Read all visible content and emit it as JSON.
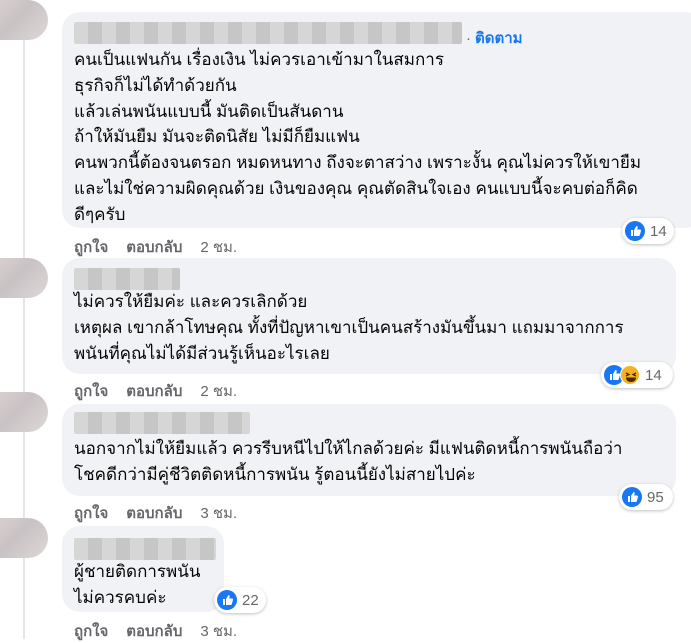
{
  "colors": {
    "bubble": "#f0f2f5",
    "link": "#1877f2",
    "secondary": "#65676b",
    "like": "#1877f2",
    "haha": "#f7b125"
  },
  "comments": [
    {
      "follow_dot": "·",
      "follow_label": "ติดตาม",
      "text": "คนเป็นแฟนกัน เรื่องเงิน ไม่ควรเอาเข้ามาในสมการ\nธุรกิจก็ไม่ได้ทำด้วยกัน\nแล้วเล่นพนันแบบนี้ มันติดเป็นสันดาน\nถ้าให้มันยืม มันจะติดนิสัย ไม่มีก็ยืมแฟน\nคนพวกนี้ต้องจนตรอก หมดหนทาง ถึงจะตาสว่าง เพราะงั้น คุณไม่ควรให้เขายืม\nและไม่ใช่ความผิดคุณด้วย เงินของคุณ คุณตัดสินใจเอง คนแบบนี้จะคบต่อก็คิด\nดีๆครับ",
      "like_label": "ถูกใจ",
      "reply_label": "ตอบกลับ",
      "time": "2 ชม.",
      "reactions": [
        "like-icon"
      ],
      "reaction_count": "14"
    },
    {
      "text": "ไม่ควรให้ยืมค่ะ และควรเลิกด้วย\nเหตุผล เขากล้าโทษคุณ ทั้งที่ปัญหาเขาเป็นคนสร้างมันขึ้นมา แถมมาจากการ\nพนันที่คุณไม่ได้มีส่วนรู้เห็นอะไรเลย",
      "like_label": "ถูกใจ",
      "reply_label": "ตอบกลับ",
      "time": "2 ชม.",
      "reactions": [
        "like-icon",
        "haha-icon"
      ],
      "reaction_count": "14"
    },
    {
      "text": "นอกจากไม่ให้ยืมแล้ว ควรรีบหนีไปให้ไกลด้วยค่ะ มีแฟนติดหนี้การพนันถือว่า\nโชคดีกว่ามีคู่ชีวิตติดหนี้การพนัน รู้ตอนนี้ยังไม่สายไปค่ะ",
      "like_label": "ถูกใจ",
      "reply_label": "ตอบกลับ",
      "time": "3 ชม.",
      "reactions": [
        "like-icon"
      ],
      "reaction_count": "95"
    },
    {
      "text": "ผู้ชายติดการพนัน\nไม่ควรคบค่ะ",
      "like_label": "ถูกใจ",
      "reply_label": "ตอบกลับ",
      "time": "3 ชม.",
      "reactions": [
        "like-icon"
      ],
      "reaction_count": "22"
    }
  ]
}
